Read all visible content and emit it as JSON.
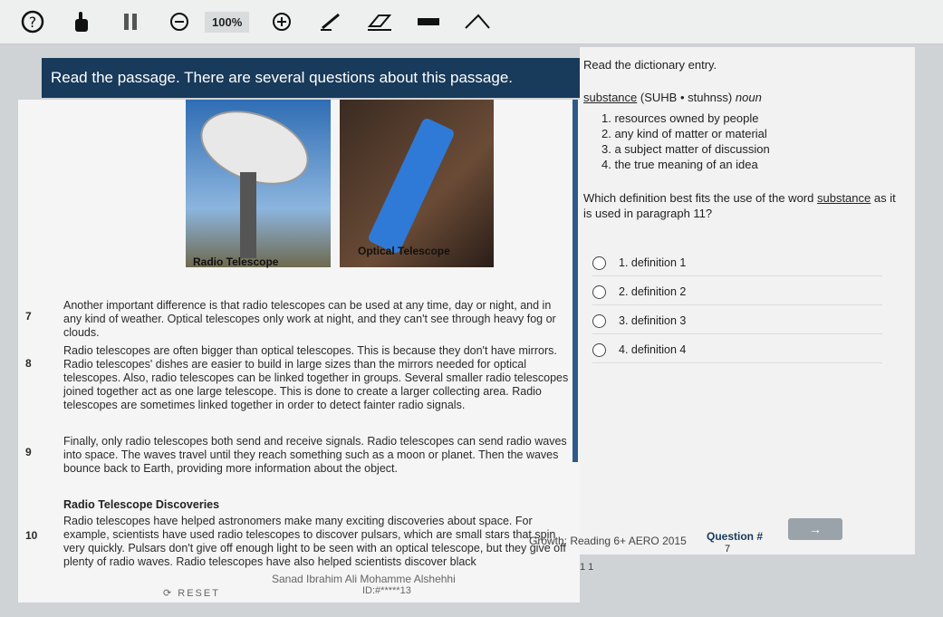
{
  "toolbar": {
    "zoom": "100%"
  },
  "banner": "Read the passage. There are several questions about this passage.",
  "images": {
    "radio_caption": "Radio Telescope",
    "optical_caption": "Optical Telescope"
  },
  "passage": {
    "p7_num": "7",
    "p7": "Another important difference is that radio telescopes can be used at any time, day or night, and in any kind of weather. Optical telescopes only work at night, and they can't see through heavy fog or clouds.",
    "p8_num": "8",
    "p8": "Radio telescopes are often bigger than optical telescopes. This is because they don't have mirrors. Radio telescopes' dishes are easier to build in large sizes than the mirrors needed for optical telescopes. Also, radio telescopes can be linked together in groups. Several smaller radio telescopes joined together act as one large telescope. This is done to create a larger collecting area. Radio telescopes are sometimes linked together in order to detect fainter radio signals.",
    "p9_num": "9",
    "p9": "Finally, only radio telescopes both send and receive signals. Radio telescopes can send radio waves into space. The waves travel until they reach something such as a moon or planet. Then the waves bounce back to Earth, providing more information about the object.",
    "heading": "Radio Telescope Discoveries",
    "p10_num": "10",
    "p10": "Radio telescopes have helped astronomers make many exciting discoveries about space. For example, scientists have used radio telescopes to discover pulsars, which are small stars that spin very quickly. Pulsars don't give off enough light to be seen with an optical telescope, but they give off plenty of radio waves. Radio telescopes have also helped scientists discover black"
  },
  "right": {
    "instruction": "Read the dictionary entry.",
    "entry_word": "substance",
    "entry_pron": "(SUHB • stuhnss)",
    "entry_pos": "noun",
    "definitions": [
      "1. resources owned by people",
      "2. any kind of matter or material",
      "3. a subject matter of discussion",
      "4. the true meaning of an idea"
    ],
    "question_pre": "Which definition best fits the use of the word",
    "question_word": "substance",
    "question_post": "as it is used in paragraph 11?",
    "options": [
      "1.  definition 1",
      "2.  definition 2",
      "3.  definition 3",
      "4.  definition 4"
    ]
  },
  "footer": {
    "reset": "RESET",
    "student": "Sanad Ibrahim Ali Mohamme Alshehhi",
    "id": "ID:#*****13",
    "test": "Growth: Reading 6+ AERO 2015",
    "pager": "1 1",
    "question_label": "Question #",
    "question_value": "7",
    "next": "→"
  }
}
